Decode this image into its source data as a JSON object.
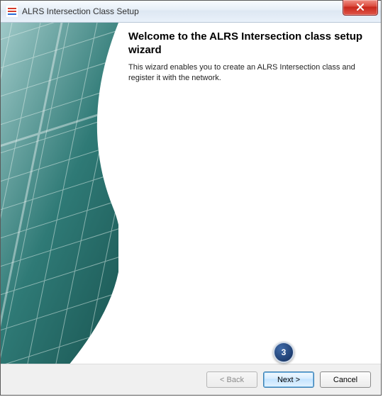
{
  "window": {
    "title": "ALRS Intersection Class Setup"
  },
  "wizard": {
    "heading": "Welcome to the ALRS Intersection class setup wizard",
    "description": "This wizard enables you to create an ALRS Intersection class and register it with the network."
  },
  "buttons": {
    "back": "< Back",
    "next": "Next >",
    "cancel": "Cancel"
  },
  "callout": {
    "number": "3"
  }
}
